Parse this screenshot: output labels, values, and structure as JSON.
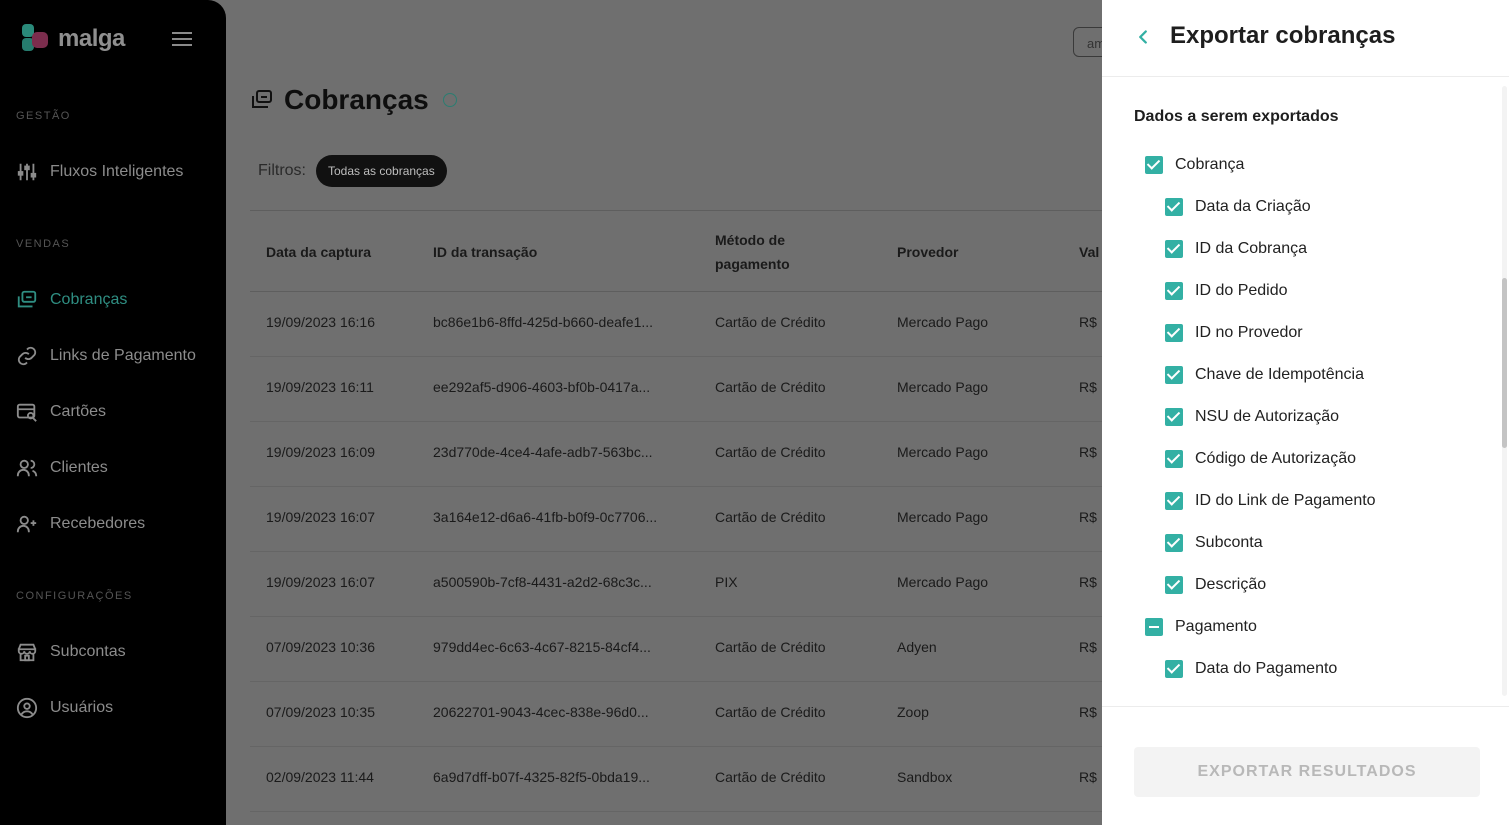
{
  "sidebar": {
    "logo_text": "malga",
    "sections": {
      "gestao": "GESTÃO",
      "vendas": "VENDAS",
      "configuracoes": "CONFIGURAÇÕES"
    },
    "items": [
      {
        "label": "Fluxos Inteligentes",
        "icon": "sliders-icon"
      },
      {
        "label": "Cobranças",
        "icon": "charges-icon",
        "active": true
      },
      {
        "label": "Links de Pagamento",
        "icon": "link-icon"
      },
      {
        "label": "Cartões",
        "icon": "card-search-icon"
      },
      {
        "label": "Clientes",
        "icon": "users-icon"
      },
      {
        "label": "Recebedores",
        "icon": "user-plus-icon"
      },
      {
        "label": "Subcontas",
        "icon": "store-icon"
      },
      {
        "label": "Usuários",
        "icon": "user-circle-icon"
      }
    ],
    "accent": "#2f8e82"
  },
  "main": {
    "top_chip": "am",
    "title": "Cobranças",
    "filters_label": "Filtros:",
    "filter_pill": "Todas as cobranças",
    "table": {
      "headers": [
        "Data da captura",
        "ID da transação",
        "Método de pagamento",
        "Provedor",
        "Val"
      ],
      "rows": [
        [
          "19/09/2023 16:16",
          "bc86e1b6-8ffd-425d-b660-deafe1...",
          "Cartão de Crédito",
          "Mercado Pago",
          "R$"
        ],
        [
          "19/09/2023 16:11",
          "ee292af5-d906-4603-bf0b-0417a...",
          "Cartão de Crédito",
          "Mercado Pago",
          "R$"
        ],
        [
          "19/09/2023 16:09",
          "23d770de-4ce4-4afe-adb7-563bc...",
          "Cartão de Crédito",
          "Mercado Pago",
          "R$"
        ],
        [
          "19/09/2023 16:07",
          "3a164e12-d6a6-41fb-b0f9-0c7706...",
          "Cartão de Crédito",
          "Mercado Pago",
          "R$"
        ],
        [
          "19/09/2023 16:07",
          "a500590b-7cf8-4431-a2d2-68c3c...",
          "PIX",
          "Mercado Pago",
          "R$"
        ],
        [
          "07/09/2023 10:36",
          "979dd4ec-6c63-4c67-8215-84cf4...",
          "Cartão de Crédito",
          "Adyen",
          "R$"
        ],
        [
          "07/09/2023 10:35",
          "20622701-9043-4cec-838e-96d0...",
          "Cartão de Crédito",
          "Zoop",
          "R$"
        ],
        [
          "02/09/2023 11:44",
          "6a9d7dff-b07f-4325-82f5-0bda19...",
          "Cartão de Crédito",
          "Sandbox",
          "R$"
        ]
      ]
    }
  },
  "drawer": {
    "title": "Exportar cobranças",
    "section_title": "Dados a serem exportados",
    "groups": [
      {
        "label": "Cobrança",
        "state": "checked"
      },
      {
        "label": "Pagamento",
        "state": "indeterminate"
      }
    ],
    "cobranca_fields": [
      "Data da Criação",
      "ID da Cobrança",
      "ID do Pedido",
      "ID no Provedor",
      "Chave de Idempotência",
      "NSU de Autorização",
      "Código de Autorização",
      "ID do Link de Pagamento",
      "Subconta",
      "Descrição"
    ],
    "pagamento_fields": [
      "Data do Pagamento"
    ],
    "export_button": "EXPORTAR RESULTADOS",
    "checkbox_color": "#33b0a4"
  }
}
